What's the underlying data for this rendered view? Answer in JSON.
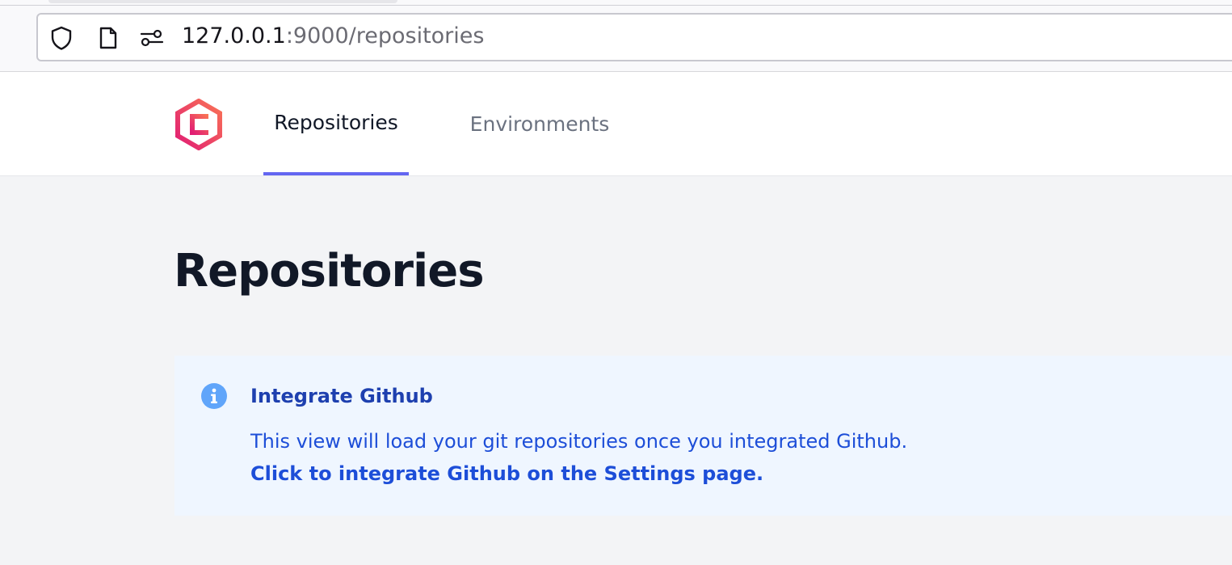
{
  "browser": {
    "url_host": "127.0.0.1",
    "url_rest": ":9000/repositories",
    "icons": [
      "shield-icon",
      "page-icon",
      "permissions-icon"
    ]
  },
  "nav": {
    "logo": "app-logo",
    "items": [
      {
        "label": "Repositories",
        "active": true
      },
      {
        "label": "Environments",
        "active": false
      }
    ],
    "accent_color": "#6366f1"
  },
  "main": {
    "title": "Repositories",
    "alert": {
      "icon": "info-icon",
      "title": "Integrate Github",
      "body": "This view will load your git repositories once you integrated Github.",
      "link": "Click to integrate Github on the Settings page.",
      "background_color": "#eff6ff",
      "text_color": "#1d4ed8"
    }
  }
}
